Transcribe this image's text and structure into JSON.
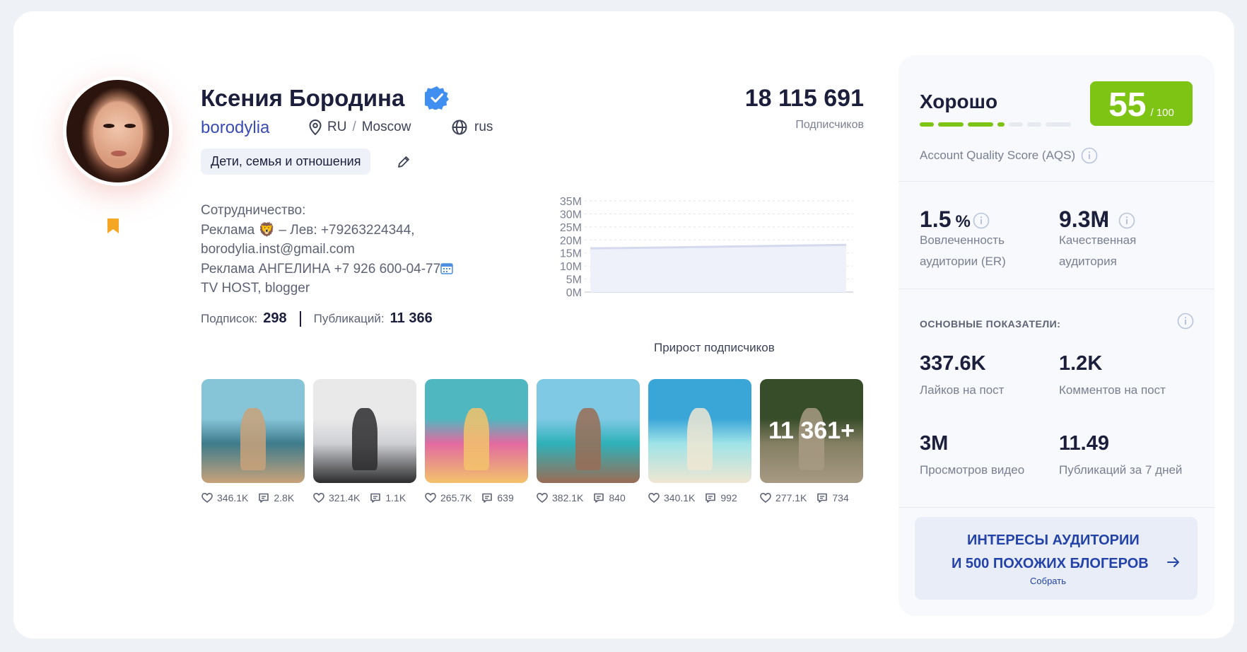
{
  "profile": {
    "name": "Ксения Бородина",
    "username": "borodylia",
    "country": "RU",
    "city": "Moscow",
    "language": "rus",
    "category": "Дети, семья и отношения",
    "followers": "18 115 691",
    "followers_label": "Подписчиков",
    "bio": [
      "Сотрудничество:",
      "Реклама 🦁 – Лев: +79263224344,",
      "borodylia.inst@gmail.com",
      "Реклама АНГЕЛИНА +7 926 600-04-77",
      "TV HOST, blogger"
    ],
    "following_label": "Подписок:",
    "following": "298",
    "posts_label": "Публикаций:",
    "posts": "11 366"
  },
  "chart_data": {
    "type": "area",
    "title": "",
    "xlabel": "Прирост подписчиков",
    "ylabel": "",
    "y_ticks": [
      "35M",
      "30M",
      "25M",
      "20M",
      "15M",
      "10M",
      "5M",
      "0M"
    ],
    "ylim": [
      0,
      35000000
    ],
    "series": [
      {
        "values": [
          16800000,
          16900000,
          17100000,
          17300000,
          17500000,
          17700000,
          17900000,
          18100000
        ]
      }
    ],
    "grid": true,
    "legend": "none"
  },
  "posts": [
    {
      "likes": "346.1K",
      "comments": "2.8K",
      "palette": [
        "#86c5d8",
        "#3d7b8c",
        "#c9a27a"
      ]
    },
    {
      "likes": "321.4K",
      "comments": "1.1K",
      "palette": [
        "#e9e9ea",
        "#cfd0d4",
        "#2c2c2e"
      ]
    },
    {
      "likes": "265.7K",
      "comments": "639",
      "palette": [
        "#4fb7c0",
        "#e26aa0",
        "#f3c36b"
      ]
    },
    {
      "likes": "382.1K",
      "comments": "840",
      "palette": [
        "#7fc9e5",
        "#2fb1b8",
        "#9a6c55"
      ]
    },
    {
      "likes": "340.1K",
      "comments": "992",
      "palette": [
        "#3aa6d8",
        "#9fe3e7",
        "#f0e6d2"
      ]
    },
    {
      "likes": "277.1K",
      "comments": "734",
      "palette": [
        "#4d6b3a",
        "#b7b08a",
        "#e9d6b6"
      ],
      "more": "11 361+"
    }
  ],
  "quality": {
    "title": "Хорошо",
    "score": "55",
    "max": "/ 100",
    "label": "Account Quality Score (AQS)",
    "accent": "#7dc414"
  },
  "metrics": {
    "er_value": "1.5",
    "er_unit": "%",
    "er_label_1": "Вовлеченность",
    "er_label_2": "аудитории (ER)",
    "qa_value": "9.3M",
    "qa_label_1": "Качественная",
    "qa_label_2": "аудитория",
    "section_title": "ОСНОВНЫЕ ПОКАЗАТЕЛИ:",
    "likes_value": "337.6K",
    "likes_label": "Лайков на пост",
    "comments_value": "1.2K",
    "comments_label": "Комментов на пост",
    "views_value": "3M",
    "views_label": "Просмотров видео",
    "pubs_value": "11.49",
    "pubs_label": "Публикаций за 7 дней"
  },
  "cta": {
    "line1": "ИНТЕРЕСЫ АУДИТОРИИ",
    "line2": "И 500 ПОХОЖИХ БЛОГЕРОВ",
    "sub": "Собрать"
  }
}
